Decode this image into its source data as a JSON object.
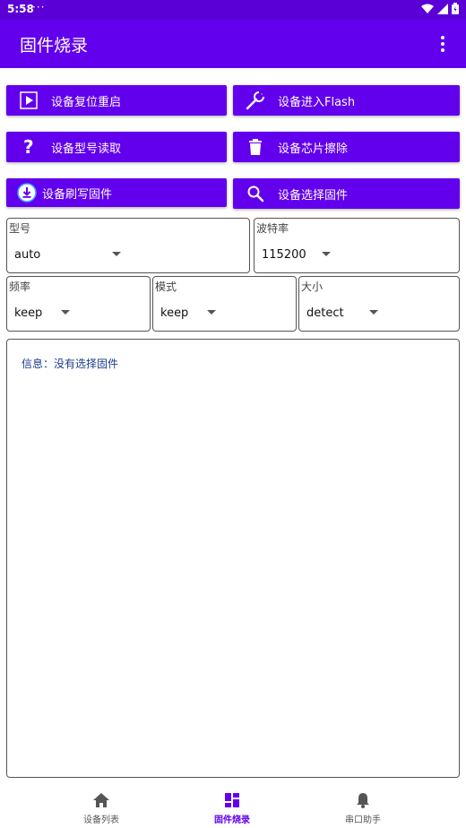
{
  "status_bar": {
    "time": "5:58",
    "dots": "···"
  },
  "app_bar": {
    "title": "固件烧录"
  },
  "buttons": {
    "reset": "设备复位重启",
    "flash_mode": "设备进入Flash",
    "read_model": "设备型号读取",
    "erase_chip": "设备芯片擦除",
    "flash_firmware": "设备刷写固件",
    "select_firmware": "设备选择固件"
  },
  "fields": {
    "model": {
      "label": "型号",
      "value": "auto"
    },
    "baud": {
      "label": "波特率",
      "value": "115200"
    },
    "freq": {
      "label": "频率",
      "value": "keep"
    },
    "mode": {
      "label": "模式",
      "value": "keep"
    },
    "size": {
      "label": "大小",
      "value": "detect"
    }
  },
  "info": {
    "text": "信息：没有选择固件"
  },
  "bottom_nav": {
    "items": [
      {
        "label": "设备列表",
        "icon": "home-icon"
      },
      {
        "label": "固件烧录",
        "icon": "dashboard-icon"
      },
      {
        "label": "串口助手",
        "icon": "bell-icon"
      }
    ]
  },
  "colors": {
    "primary": "#6200ee",
    "status_bar": "#5a00d6",
    "info_text": "#1a3a8a"
  }
}
